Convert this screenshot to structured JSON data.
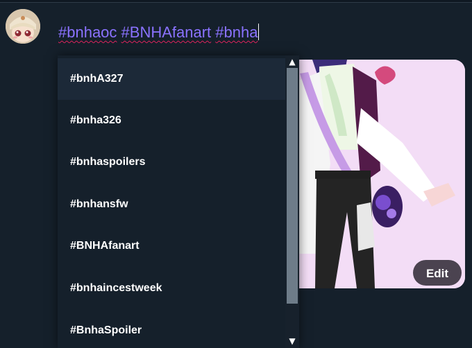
{
  "composer": {
    "hashtags": [
      "#bnhaoc",
      "#BNHAfanart",
      "#bnha"
    ]
  },
  "media": {
    "edit_label": "Edit"
  },
  "suggestions": {
    "items": [
      {
        "label": "#bnhA327"
      },
      {
        "label": "#bnha326"
      },
      {
        "label": "#bnhaspoilers"
      },
      {
        "label": "#bnhansfw"
      },
      {
        "label": "#BNHAfanart"
      },
      {
        "label": "#bnhaincestweek"
      },
      {
        "label": "#BnhaSpoiler"
      }
    ],
    "highlighted_index": 0
  },
  "scrollbar": {
    "up_icon": "chevron-up-icon",
    "down_icon": "chevron-down-icon"
  },
  "colors": {
    "background": "#15202b",
    "hashtag": "#8a72ff",
    "spellcheck": "#e0245e",
    "highlight": "#1c2938"
  }
}
